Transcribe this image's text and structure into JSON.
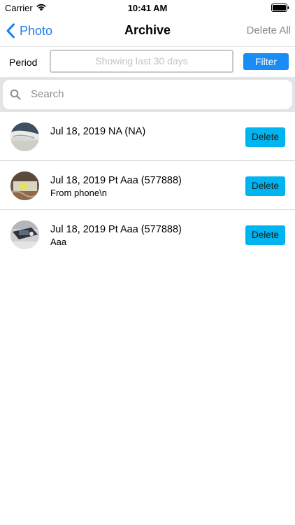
{
  "status_bar": {
    "carrier": "Carrier",
    "time": "10:41 AM"
  },
  "nav": {
    "back_label": "Photo",
    "title": "Archive",
    "delete_all": "Delete All"
  },
  "filter": {
    "period_label": "Period",
    "period_placeholder": "Showing last 30 days",
    "filter_button": "Filter"
  },
  "search": {
    "placeholder": "Search"
  },
  "items": [
    {
      "title": "Jul 18, 2019 NA (NA)",
      "subtitle": "",
      "delete_label": "Delete"
    },
    {
      "title": "Jul 18, 2019 Pt Aaa (577888)",
      "subtitle": "From phone\\n",
      "delete_label": "Delete"
    },
    {
      "title": "Jul 18, 2019 Pt Aaa (577888)",
      "subtitle": "Aaa",
      "delete_label": "Delete"
    }
  ],
  "colors": {
    "accent": "#1a7ef0",
    "filter_button": "#1a8cf6",
    "delete_button": "#00b4f0",
    "search_bar_bg": "#e4e4e6"
  }
}
